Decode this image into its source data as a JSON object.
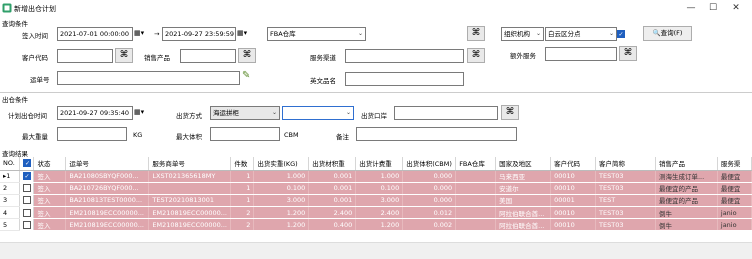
{
  "window": {
    "title": "新增出仓计划"
  },
  "query": {
    "section_label": "查询条件",
    "sign_time_label": "签入时间",
    "sign_time_from": "2021-07-01 00:00:00",
    "arrow": "→",
    "sign_time_to": "2021-09-27 23:59:59",
    "warehouse_value": "FBA仓库",
    "org_select": "组织机构",
    "org_value": "白云区分点",
    "search_label": "查询(F)",
    "customer_code_label": "客户代码",
    "sales_product_label": "销售产品",
    "service_channel_label": "服务渠道",
    "extra_service_label": "额外服务",
    "waybill_label": "运单号",
    "english_name_label": "英文品名"
  },
  "outbound": {
    "section_label": "出仓条件",
    "plan_time_label": "计划出仓时间",
    "plan_time_value": "2021-09-27 09:35:40",
    "method_label": "出货方式",
    "method_value": "海运拼柜",
    "port_label": "出货口岸",
    "max_weight_label": "最大重量",
    "weight_unit": "KG",
    "max_volume_label": "最大体积",
    "volume_unit": "CBM",
    "remark_label": "备注"
  },
  "results": {
    "section_label": "查询结果",
    "columns": [
      "NO.",
      "",
      "状态",
      "运单号",
      "服务商单号",
      "件数",
      "出货实重(KG)",
      "出货材积重",
      "出货计费重",
      "出货体积(CBM)",
      "FBA仓库",
      "国家及地区",
      "客户代码",
      "客户简称",
      "销售产品",
      "服务渠"
    ],
    "rows": [
      {
        "no": "1",
        "marker": "▸",
        "checked": true,
        "status": "签入",
        "waybill": "BA21080SBYQF000...",
        "provider_no": "LXST021365618MY",
        "pieces": "1",
        "weight": "1.000",
        "vol_weight": "0.001",
        "charge_weight": "1.000",
        "cbm": "0.000",
        "fba": "",
        "country": "马来西亚",
        "cust_code": "00010",
        "cust_name": "TEST03",
        "product": "测海生成订单...",
        "channel": "最便宜"
      },
      {
        "no": "2",
        "marker": "",
        "checked": false,
        "status": "签入",
        "waybill": "BA210726BYQF000...",
        "provider_no": "",
        "pieces": "1",
        "weight": "0.100",
        "vol_weight": "0.001",
        "charge_weight": "0.100",
        "cbm": "0.000",
        "fba": "",
        "country": "安道尔",
        "cust_code": "00010",
        "cust_name": "TEST03",
        "product": "最便宜的产品",
        "channel": "最便宜"
      },
      {
        "no": "3",
        "marker": "",
        "checked": false,
        "status": "签入",
        "waybill": "BA210813TEST0000...",
        "provider_no": "TEST20210813001",
        "pieces": "1",
        "weight": "3.000",
        "vol_weight": "0.001",
        "charge_weight": "3.000",
        "cbm": "0.000",
        "fba": "",
        "country": "美国",
        "cust_code": "00001",
        "cust_name": "TEST",
        "product": "最便宜的产品",
        "channel": "最便宜"
      },
      {
        "no": "4",
        "marker": "",
        "checked": false,
        "status": "签入",
        "waybill": "EM210819ECC00000...",
        "provider_no": "EM210819ECC00000...",
        "pieces": "2",
        "weight": "1.200",
        "vol_weight": "2.400",
        "charge_weight": "2.400",
        "cbm": "0.012",
        "fba": "",
        "country": "阿拉伯联合酋...",
        "cust_code": "00010",
        "cust_name": "TEST03",
        "product": "倒牛",
        "channel": "janio"
      },
      {
        "no": "5",
        "marker": "",
        "checked": false,
        "status": "签入",
        "waybill": "EM210819ECC00000...",
        "provider_no": "EM210819ECC00000...",
        "pieces": "2",
        "weight": "1.200",
        "vol_weight": "0.400",
        "charge_weight": "1.200",
        "cbm": "0.002",
        "fba": "",
        "country": "阿拉伯联合酋...",
        "cust_code": "00010",
        "cust_name": "TEST03",
        "product": "倒牛",
        "channel": "janio"
      }
    ]
  },
  "icons": {
    "calendar": "calendar-icon",
    "binoculars": "binoculars-icon",
    "magnifier": "search-icon"
  }
}
